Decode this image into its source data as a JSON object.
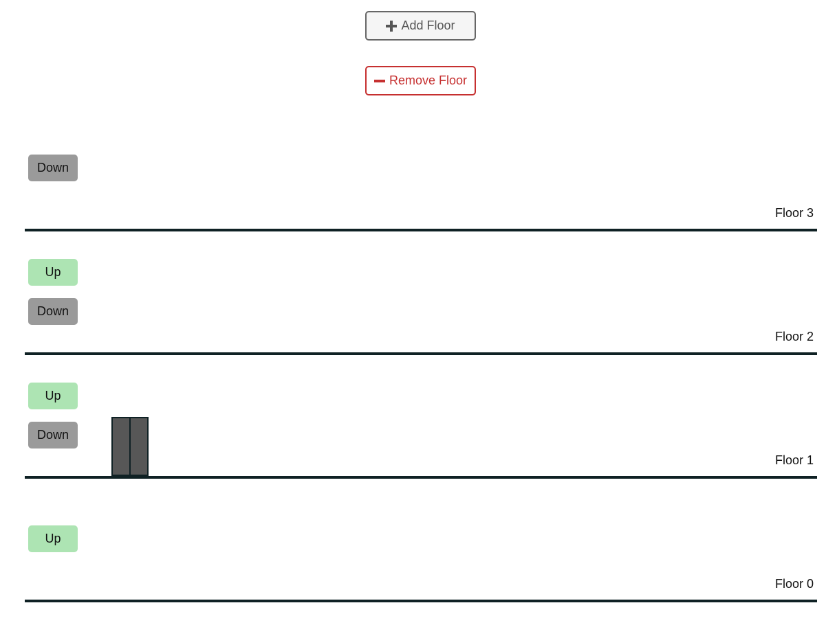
{
  "controls": {
    "add_label": "Add Floor",
    "remove_label": "Remove Floor"
  },
  "floors": [
    {
      "label": "Floor 3",
      "up_label": null,
      "down_label": "Down"
    },
    {
      "label": "Floor 2",
      "up_label": "Up",
      "down_label": "Down"
    },
    {
      "label": "Floor 1",
      "up_label": "Up",
      "down_label": "Down"
    },
    {
      "label": "Floor 0",
      "up_label": "Up",
      "down_label": null
    }
  ],
  "colors": {
    "floor_line": "#0f2124",
    "up_button": "#ade4b3",
    "down_button": "#9a9a9a",
    "elevator": "#575757",
    "remove_accent": "#c63030"
  }
}
